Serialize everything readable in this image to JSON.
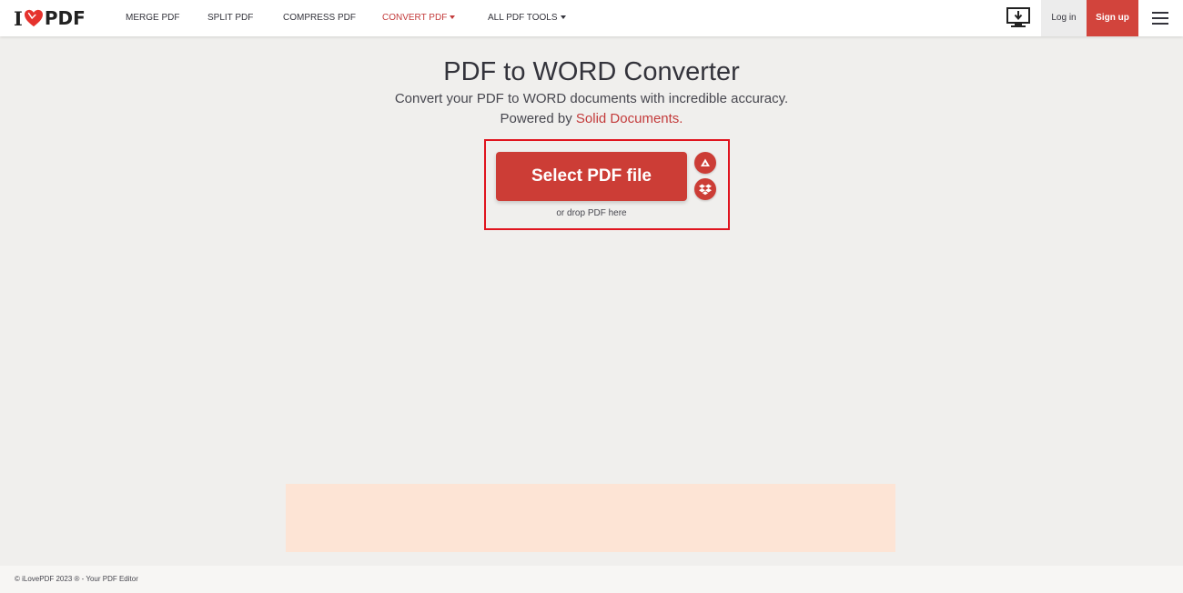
{
  "header": {
    "logo": {
      "prefix": "I",
      "suffix": "PDF",
      "heart_color": "#e5322d"
    },
    "nav": [
      {
        "label": "MERGE PDF",
        "active": false,
        "dropdown": false
      },
      {
        "label": "SPLIT PDF",
        "active": false,
        "dropdown": false
      },
      {
        "label": "COMPRESS PDF",
        "active": false,
        "dropdown": false
      },
      {
        "label": "CONVERT PDF",
        "active": true,
        "dropdown": true
      },
      {
        "label": "ALL PDF TOOLS",
        "active": false,
        "dropdown": true
      }
    ],
    "desktop_icon": "desktop-download-icon",
    "login_label": "Log in",
    "signup_label": "Sign up",
    "menu_icon": "hamburger-menu-icon"
  },
  "main": {
    "title": "PDF to WORD Converter",
    "subtitle": "Convert your PDF to WORD documents with incredible accuracy.",
    "powered_prefix": "Powered by ",
    "powered_link": "Solid Documents.",
    "select_button": "Select PDF file",
    "cloud_buttons": [
      "google-drive-icon",
      "dropbox-icon"
    ],
    "drop_hint": "or drop PDF here"
  },
  "footer": {
    "text": "© iLovePDF 2023 ® - Your PDF Editor"
  },
  "colors": {
    "brand_red": "#cc3d36",
    "signup_red": "#d2443c",
    "active_nav": "#c33b3b",
    "highlight_border": "#e0141e",
    "background": "#f0efed",
    "ad_background": "#fde4d5"
  }
}
